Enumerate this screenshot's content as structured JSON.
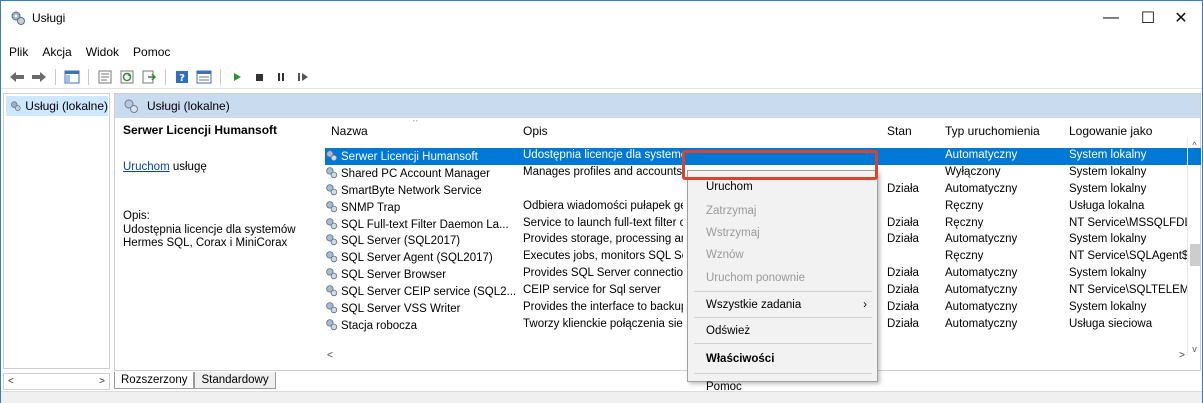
{
  "window": {
    "title": "Usługi",
    "minimize": "—",
    "maximize": "☐",
    "close": "✕"
  },
  "menu": [
    "Plik",
    "Akcja",
    "Widok",
    "Pomoc"
  ],
  "toolbar": {
    "icons": [
      "back-arrow-icon",
      "forward-arrow-icon",
      "show-hide-console-tree-icon",
      "properties-icon",
      "refresh-icon",
      "export-list-icon",
      "help-icon",
      "details-view-icon",
      "start-icon",
      "stop-icon",
      "pause-icon",
      "resume-icon"
    ]
  },
  "left": {
    "item_label": "Usługi (lokalne)",
    "scroll_left": "<",
    "scroll_right": ">"
  },
  "main": {
    "header_label": "Usługi (lokalne)",
    "detail": {
      "service_name": "Serwer Licencji Humansoft",
      "start_link": "Uruchom",
      "start_suffix": " usługę",
      "desc_label": "Opis:",
      "desc_text": "Udostępnia licencje dla systemów Hermes SQL, Corax i MiniCorax"
    },
    "columns": [
      "Nazwa",
      "Opis",
      "Stan",
      "Typ uruchomienia",
      "Logowanie jako"
    ],
    "rows": [
      {
        "name": "Serwer Licencji Humansoft",
        "desc": "Udostępnia licencje dla systemo",
        "state": "",
        "startup": "Automatyczny",
        "logon": "System lokalny",
        "selected": true
      },
      {
        "name": "Shared PC Account Manager",
        "desc": "Manages profiles and accounts",
        "state": "",
        "startup": "Wyłączony",
        "logon": "System lokalny"
      },
      {
        "name": "SmartByte Network Service",
        "desc": "",
        "state": "Działa",
        "startup": "Automatyczny",
        "logon": "System lokalny"
      },
      {
        "name": "SNMP Trap",
        "desc": "Odbiera wiadomości pułapek ge",
        "state": "",
        "startup": "Ręczny",
        "logon": "Usługa lokalna"
      },
      {
        "name": "SQL Full-text Filter Daemon La...",
        "desc": "Service to launch full-text filter c",
        "state": "Działa",
        "startup": "Ręczny",
        "logon": "NT Service\\MSSQLFDLa"
      },
      {
        "name": "SQL Server (SQL2017)",
        "desc": "Provides storage, processing an",
        "state": "Działa",
        "startup": "Automatyczny",
        "logon": "System lokalny"
      },
      {
        "name": "SQL Server Agent (SQL2017)",
        "desc": "Executes jobs, monitors SQL Ser",
        "state": "",
        "startup": "Ręczny",
        "logon": "NT Service\\SQLAgent$"
      },
      {
        "name": "SQL Server Browser",
        "desc": "Provides SQL Server connection",
        "state": "Działa",
        "startup": "Automatyczny",
        "logon": "System lokalny"
      },
      {
        "name": "SQL Server CEIP service (SQL2...",
        "desc": "CEIP service for Sql server",
        "state": "Działa",
        "startup": "Automatyczny",
        "logon": "NT Service\\SQLTELEME"
      },
      {
        "name": "SQL Server VSS Writer",
        "desc": "Provides the interface to backup",
        "state": "Działa",
        "startup": "Automatyczny",
        "logon": "System lokalny"
      },
      {
        "name": "Stacja robocza",
        "desc": "Tworzy klienckie połączenia siec",
        "state": "Działa",
        "startup": "Automatyczny",
        "logon": "Usługa sieciowa"
      }
    ],
    "tabs": [
      "Rozszerzony",
      "Standardowy"
    ]
  },
  "context_menu": [
    {
      "label": "Uruchom",
      "disabled": false,
      "bold": false
    },
    {
      "label": "Zatrzymaj",
      "disabled": true
    },
    {
      "label": "Wstrzymaj",
      "disabled": true
    },
    {
      "label": "Wznów",
      "disabled": true
    },
    {
      "label": "Uruchom ponownie",
      "disabled": true
    },
    {
      "label": "Wszystkie zadania",
      "submenu": true
    },
    {
      "label": "Odśwież"
    },
    {
      "label": "Właściwości",
      "bold": true
    },
    {
      "label": "Pomoc"
    }
  ],
  "colors": {
    "selection": "#0078d7",
    "header_band": "#c9dbee",
    "highlight_box": "#d9452a"
  }
}
